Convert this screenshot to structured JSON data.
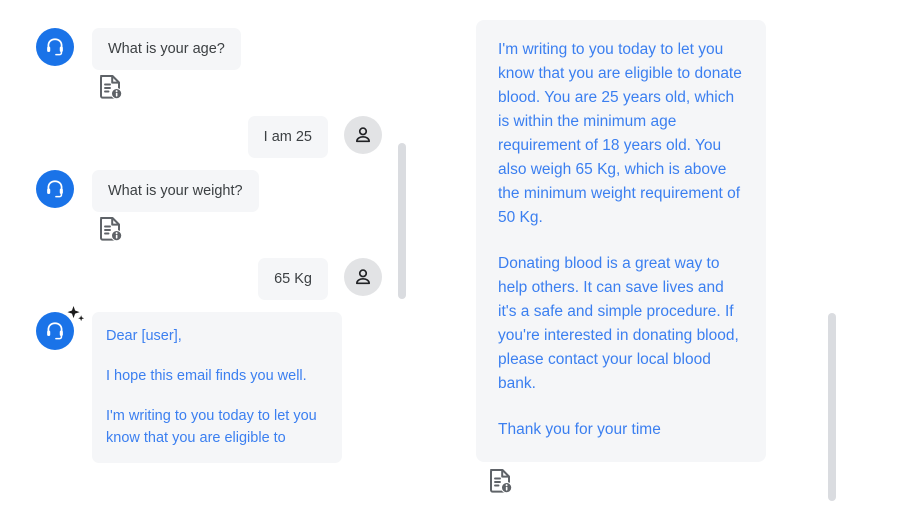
{
  "colors": {
    "agent_avatar_blue": "#1a73e8",
    "user_avatar_grey": "#e2e3e5",
    "bubble_bg": "#f5f6f8",
    "bubble_text": "#3c4043",
    "ai_text_blue": "#3b7ff0",
    "scrollbar_thumb": "#dadce0",
    "page_bg": "#ffffff"
  },
  "left_panel": {
    "messages": [
      {
        "sender": "agent",
        "avatar_icon": "headset-icon",
        "text": "What is your age?",
        "attachment_icon": "document-info-icon"
      },
      {
        "sender": "user",
        "avatar_icon": "person-icon",
        "text": "I am 25"
      },
      {
        "sender": "agent",
        "avatar_icon": "headset-icon",
        "text": "What is your weight?",
        "attachment_icon": "document-info-icon"
      },
      {
        "sender": "user",
        "avatar_icon": "person-icon",
        "text": "65 Kg"
      }
    ],
    "ai_message": {
      "sender": "agent",
      "avatar_icon": "headset-icon",
      "badge_icon": "sparkle-icon",
      "paragraphs": [
        "Dear [user],",
        "I hope this email finds you well.",
        "I'm writing to you today to let you know that you are eligible to"
      ]
    },
    "scrollbar": {
      "icon": "scrollbar-thumb"
    }
  },
  "right_panel": {
    "bubble": {
      "paragraphs": [
        "I'm writing to you today to let you know that you are eligible to donate blood. You are 25 years old, which is within the minimum age requirement of 18 years old. You also weigh 65 Kg, which is above the minimum weight requirement of 50 Kg.",
        "Donating blood is a great way to help others. It can save lives and it's a safe and simple procedure. If you're interested in donating blood, please contact your local blood bank.",
        "Thank you for your time"
      ]
    },
    "attachment_icon": "document-info-icon",
    "scrollbar": {
      "icon": "scrollbar-thumb"
    }
  }
}
